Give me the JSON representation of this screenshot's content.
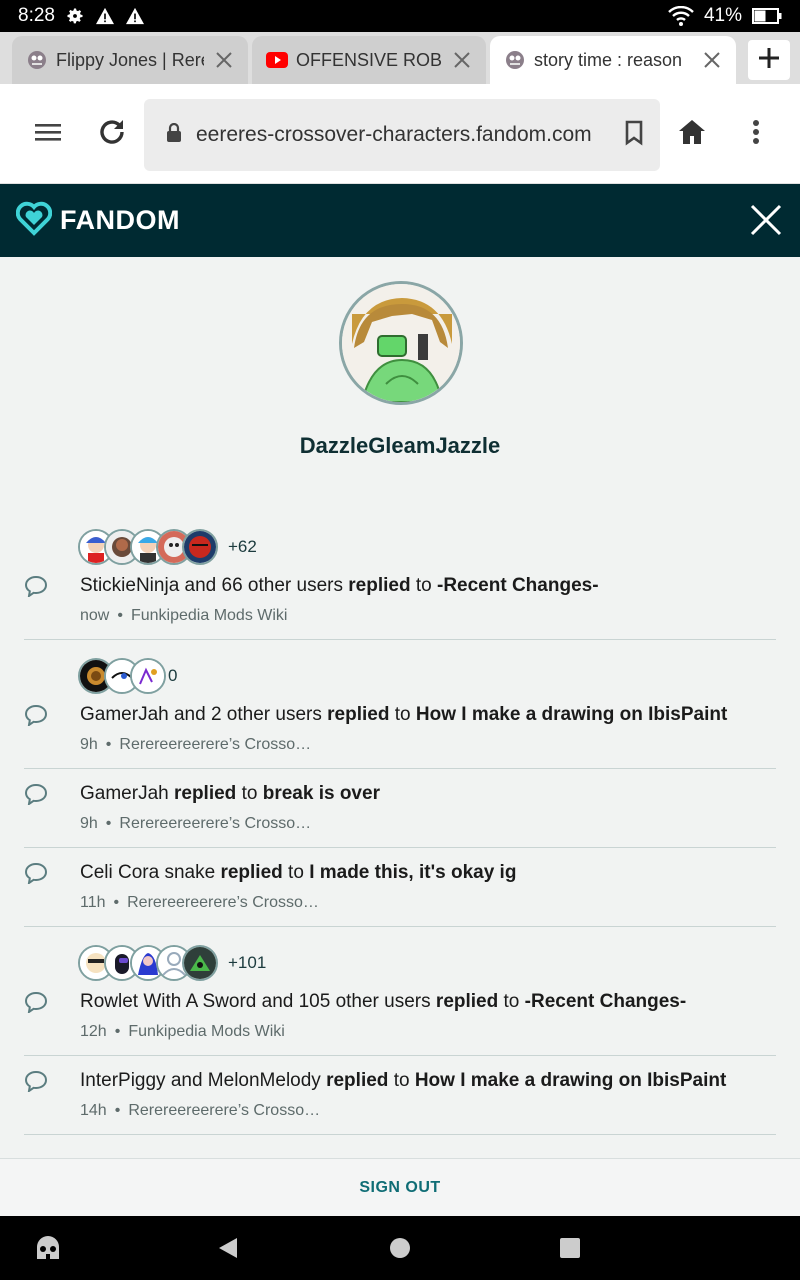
{
  "status": {
    "time": "8:28",
    "battery": "41%"
  },
  "tabs": [
    {
      "title": "Flippy Jones | Rerer",
      "favicon": "wiki-favicon",
      "active": false
    },
    {
      "title": "OFFENSIVE ROBLO",
      "favicon": "youtube-favicon",
      "active": false
    },
    {
      "title": "story time : reason",
      "favicon": "wiki-favicon",
      "active": true
    }
  ],
  "toolbar": {
    "url": "eereres-crossover-characters.fandom.com"
  },
  "fandom": {
    "logo_text": "FANDOM"
  },
  "profile": {
    "username": "DazzleGleamJazzle"
  },
  "feed": [
    {
      "has_avatars": true,
      "avatar_count": 5,
      "more": "+62",
      "actor": "StickieNinja and 66 other users",
      "verb": "replied",
      "prep": "to",
      "target": "-Recent Changes-",
      "time": "now",
      "wiki": "Funkipedia Mods Wiki"
    },
    {
      "has_avatars": true,
      "avatar_count": 3,
      "more": "0",
      "actor": "GamerJah and 2 other users",
      "verb": "replied",
      "prep": "to",
      "target": "How I make a drawing on IbisPaint",
      "time": "9h",
      "wiki": "Rerereereerere’s Crosso…"
    },
    {
      "has_avatars": false,
      "actor": "GamerJah",
      "verb": "replied",
      "prep": "to",
      "target": "break is over",
      "time": "9h",
      "wiki": "Rerereereerere’s Crosso…"
    },
    {
      "has_avatars": false,
      "actor": "Celi Cora snake",
      "verb": "replied",
      "prep": "to",
      "target": "I made this, it's okay ig",
      "time": "11h",
      "wiki": "Rerereereerere’s Crosso…"
    },
    {
      "has_avatars": true,
      "avatar_count": 5,
      "more": "+101",
      "actor": "Rowlet With A Sword and 105 other users",
      "verb": "replied",
      "prep": "to",
      "target": "-Recent Changes-",
      "time": "12h",
      "wiki": "Funkipedia Mods Wiki"
    },
    {
      "has_avatars": false,
      "actor": "InterPiggy and MelonMelody",
      "verb": "replied",
      "prep": "to",
      "target": "How I make a drawing on IbisPaint",
      "time": "14h",
      "wiki": "Rerereereerere’s Crosso…"
    }
  ],
  "footer": {
    "signout": "SIGN OUT"
  },
  "colors": {
    "fandom_header": "#002a32",
    "accent": "#0f6d75",
    "page_bg": "#f1f3f2"
  }
}
